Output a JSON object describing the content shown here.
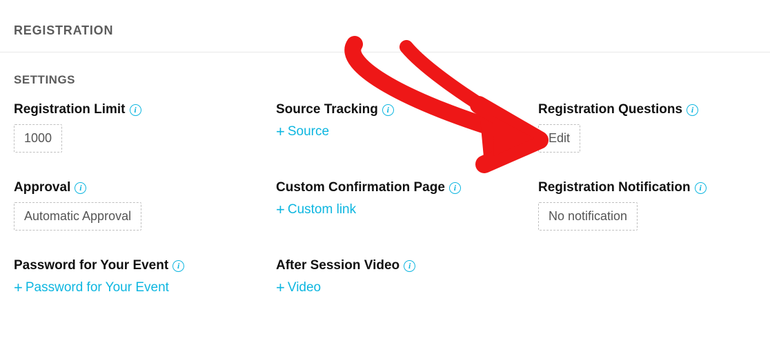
{
  "page": {
    "title": "REGISTRATION"
  },
  "section": {
    "title": "SETTINGS"
  },
  "fields": {
    "reg_limit": {
      "label": "Registration Limit",
      "value": "1000"
    },
    "source_tracking": {
      "label": "Source Tracking",
      "add_label": "Source"
    },
    "reg_questions": {
      "label": "Registration Questions",
      "button": "Edit"
    },
    "approval": {
      "label": "Approval",
      "value": "Automatic Approval"
    },
    "custom_conf": {
      "label": "Custom Confirmation Page",
      "add_label": "Custom link"
    },
    "reg_notification": {
      "label": "Registration Notification",
      "value": "No notification"
    },
    "password": {
      "label": "Password for Your Event",
      "add_label": "Password for Your Event"
    },
    "after_video": {
      "label": "After Session Video",
      "add_label": "Video"
    }
  },
  "ui": {
    "plus": "+",
    "info": "i"
  }
}
